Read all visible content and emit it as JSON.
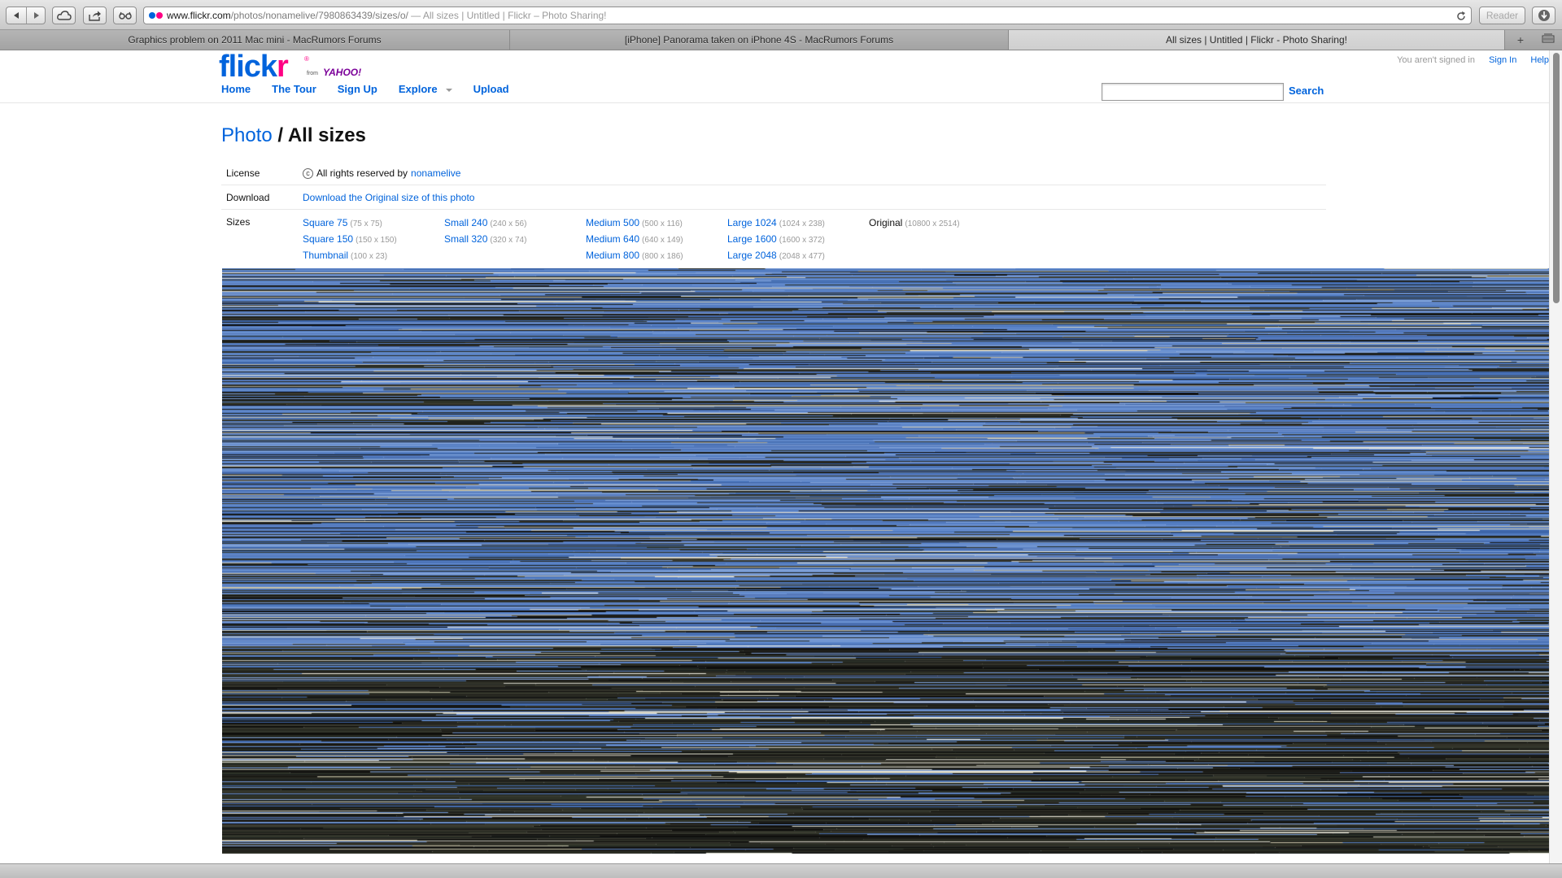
{
  "browser": {
    "url_host": "www.flickr.com",
    "url_path": "/photos/nonamelive/7980863439/sizes/o/",
    "url_title": " — All sizes | Untitled | Flickr – Photo Sharing!",
    "reader_label": "Reader",
    "tabs": [
      {
        "label": "Graphics problem on 2011 Mac mini - MacRumors Forums",
        "active": false
      },
      {
        "label": "[iPhone] Panorama taken on iPhone 4S - MacRumors Forums",
        "active": false
      },
      {
        "label": "All sizes | Untitled | Flickr - Photo Sharing!",
        "active": true
      }
    ],
    "new_tab_symbol": "+"
  },
  "header": {
    "logo_part1": "flick",
    "logo_part2": "r",
    "logo_registered": "®",
    "logo_from": "from",
    "logo_yahoo": "YAHOO!",
    "signed_out_text": "You aren't signed in",
    "sign_in": "Sign In",
    "help": "Help",
    "nav": [
      "Home",
      "The Tour",
      "Sign Up",
      "Explore",
      "Upload"
    ],
    "search_button": "Search",
    "search_value": ""
  },
  "page": {
    "title_link": "Photo",
    "title_sep": "/",
    "title_current": "All sizes",
    "license_label": "License",
    "license_symbol": "c",
    "license_text": "All rights reserved by",
    "license_owner": "nonamelive",
    "download_label": "Download",
    "download_link": "Download the Original size of this photo",
    "sizes_label": "Sizes",
    "size_columns": [
      [
        {
          "name": "Square 75",
          "dim": "(75 x 75)"
        },
        {
          "name": "Square 150",
          "dim": "(150 x 150)"
        },
        {
          "name": "Thumbnail",
          "dim": "(100 x 23)"
        }
      ],
      [
        {
          "name": "Small 240",
          "dim": "(240 x 56)"
        },
        {
          "name": "Small 320",
          "dim": "(320 x 74)"
        }
      ],
      [
        {
          "name": "Medium 500",
          "dim": "(500 x 116)"
        },
        {
          "name": "Medium 640",
          "dim": "(640 x 149)"
        },
        {
          "name": "Medium 800",
          "dim": "(800 x 186)"
        }
      ],
      [
        {
          "name": "Large 1024",
          "dim": "(1024 x 238)"
        },
        {
          "name": "Large 1600",
          "dim": "(1600 x 372)"
        },
        {
          "name": "Large 2048",
          "dim": "(2048 x 477)"
        }
      ],
      [
        {
          "name": "Original",
          "dim": "(10800 x 2514)",
          "current": true
        }
      ]
    ]
  },
  "colors": {
    "flickr_blue": "#0063dc",
    "flickr_pink": "#ff0084",
    "yahoo_purple": "#7b0099",
    "photo_sky": "#5b84c8",
    "photo_dark": "#1c1c18"
  }
}
